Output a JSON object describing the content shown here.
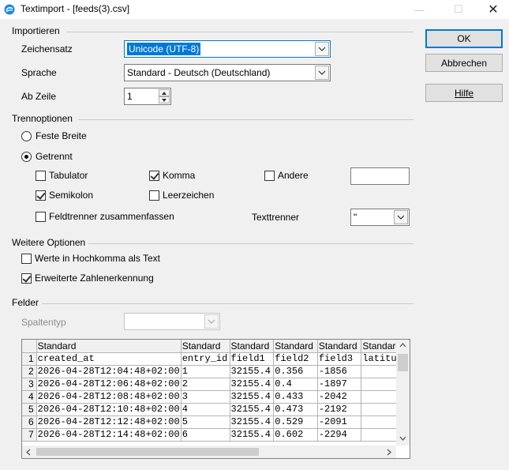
{
  "window": {
    "title": "Textimport - [feeds(3).csv]"
  },
  "buttons": {
    "ok": "OK",
    "cancel": "Abbrechen",
    "help": "Hilfe"
  },
  "import": {
    "group": "Importieren",
    "charset_label": "Zeichensatz",
    "charset_value": "Unicode (UTF-8)",
    "language_label": "Sprache",
    "language_value": "Standard - Deutsch (Deutschland)",
    "from_row_label": "Ab Zeile",
    "from_row_value": "1"
  },
  "separator": {
    "group": "Trennoptionen",
    "fixed_width": "Feste Breite",
    "separated": "Getrennt",
    "tab": "Tabulator",
    "comma": "Komma",
    "other": "Andere",
    "semicolon": "Semikolon",
    "space": "Leerzeichen",
    "merge": "Feldtrenner zusammenfassen",
    "text_delim_label": "Texttrenner",
    "text_delim_value": "\"",
    "checked": {
      "tab": false,
      "comma": true,
      "other": false,
      "semicolon": true,
      "space": false,
      "merge": false
    }
  },
  "other_options": {
    "group": "Weitere Optionen",
    "quoted_as_text": "Werte in Hochkomma als Text",
    "detect_numbers": "Erweiterte Zahlenerkennung",
    "checked": {
      "quoted_as_text": false,
      "detect_numbers": true
    }
  },
  "fields": {
    "group": "Felder",
    "column_type_label": "Spaltentyp",
    "column_type_value": ""
  },
  "grid": {
    "headers": [
      "Standard",
      "Standard",
      "Standard",
      "Standard",
      "Standard",
      "Standard"
    ],
    "rows": [
      [
        "1",
        "created_at",
        "entry_id",
        "field1",
        "field2",
        "field3",
        "latitude"
      ],
      [
        "2",
        "2026-04-28T12:04:48+02:00",
        "1",
        "32155.4",
        "0.356",
        "-1856",
        ""
      ],
      [
        "3",
        "2026-04-28T12:06:48+02:00",
        "2",
        "32155.4",
        "0.4",
        "-1897",
        ""
      ],
      [
        "4",
        "2026-04-28T12:08:48+02:00",
        "3",
        "32155.4",
        "0.433",
        "-2042",
        ""
      ],
      [
        "5",
        "2026-04-28T12:10:48+02:00",
        "4",
        "32155.4",
        "0.473",
        "-2192",
        ""
      ],
      [
        "6",
        "2026-04-28T12:12:48+02:00",
        "5",
        "32155.4",
        "0.529",
        "-2091",
        ""
      ],
      [
        "7",
        "2026-04-28T12:14:48+02:00",
        "6",
        "32155.4",
        "0.602",
        "-2294",
        ""
      ]
    ]
  },
  "icons": {
    "app": "libreoffice-icon",
    "minimize": "minimize-icon",
    "maximize": "maximize-icon",
    "close": "close-icon"
  }
}
